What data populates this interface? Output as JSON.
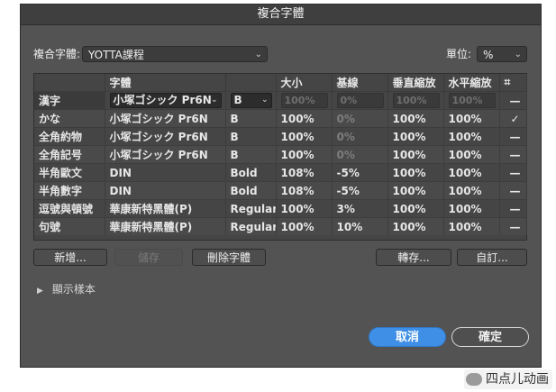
{
  "window": {
    "title": "複合字體"
  },
  "composite": {
    "label": "複合字體:",
    "value": "YOTTA課程"
  },
  "unit": {
    "label": "單位:",
    "value": "%"
  },
  "table": {
    "headers": [
      "",
      "字體",
      "",
      "大小",
      "基線",
      "垂直縮放",
      "水平縮放",
      "⌗"
    ],
    "rows": [
      {
        "name": "漢字",
        "font": "小塚ゴシック Pr6N",
        "style": "B",
        "size": "100%",
        "baseline": "0%",
        "vscale": "100%",
        "hscale": "100%",
        "flag": "—",
        "selected": true
      },
      {
        "name": "かな",
        "font": "小塚ゴシック Pr6N",
        "style": "B",
        "size": "100%",
        "baseline": "0%",
        "vscale": "100%",
        "hscale": "100%",
        "flag": "✓",
        "selected": false
      },
      {
        "name": "全角約物",
        "font": "小塚ゴシック Pr6N",
        "style": "B",
        "size": "100%",
        "baseline": "0%",
        "vscale": "100%",
        "hscale": "100%",
        "flag": "—",
        "selected": false
      },
      {
        "name": "全角記号",
        "font": "小塚ゴシック Pr6N",
        "style": "B",
        "size": "100%",
        "baseline": "0%",
        "vscale": "100%",
        "hscale": "100%",
        "flag": "—",
        "selected": false
      },
      {
        "name": "半角歐文",
        "font": "DIN",
        "style": "Bold",
        "size": "108%",
        "baseline": "-5%",
        "vscale": "100%",
        "hscale": "100%",
        "flag": "—",
        "selected": false
      },
      {
        "name": "半角數字",
        "font": "DIN",
        "style": "Bold",
        "size": "108%",
        "baseline": "-5%",
        "vscale": "100%",
        "hscale": "100%",
        "flag": "—",
        "selected": false
      },
      {
        "name": "逗號與頓號",
        "font": "華康新特黑體(P)",
        "style": "Regular",
        "size": "100%",
        "baseline": "3%",
        "vscale": "100%",
        "hscale": "100%",
        "flag": "—",
        "selected": false
      },
      {
        "name": "句號",
        "font": "華康新特黑體(P)",
        "style": "Regular",
        "size": "100%",
        "baseline": "10%",
        "vscale": "100%",
        "hscale": "100%",
        "flag": "—",
        "selected": false
      }
    ]
  },
  "buttons": {
    "new": "新增...",
    "save": "儲存",
    "delete": "刪除字體",
    "export": "轉存...",
    "custom": "自訂..."
  },
  "preview": {
    "label": "顯示樣本"
  },
  "footer": {
    "cancel": "取消",
    "ok": "確定"
  },
  "watermark": {
    "text": "四点儿动画"
  }
}
